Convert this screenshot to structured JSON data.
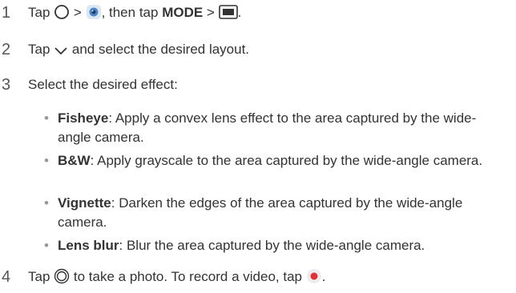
{
  "steps": [
    {
      "number": "1",
      "text_a": "Tap",
      "text_b": ">",
      "text_c": ", then tap",
      "mode_label": "MODE",
      "text_d": ">",
      "text_e": "."
    },
    {
      "number": "2",
      "text_a": "Tap",
      "text_b": "and select the desired layout."
    },
    {
      "number": "3",
      "text": "Select the desired effect:"
    },
    {
      "number": "4",
      "text_a": "Tap",
      "text_b": "to take a photo. To record a video, tap",
      "text_c": "."
    }
  ],
  "effects": [
    {
      "name": "Fisheye",
      "description": ": Apply a convex lens effect to the area captured by the wide-angle camera."
    },
    {
      "name": "B&W",
      "description": ": Apply grayscale to the area captured by the wide-angle camera."
    },
    {
      "name": "Vignette",
      "description": ": Darken the edges of the area captured by the wide-angle camera."
    },
    {
      "name": "Lens blur",
      "description": ": Blur the area captured by the wide-angle camera."
    }
  ],
  "bullet_char": "•",
  "icons": {
    "home": "home-circle-icon",
    "camera_app": "camera-app-icon",
    "mode_layout": "layout-mode-icon",
    "dropdown": "chevron-down-icon",
    "shutter": "shutter-icon",
    "record": "record-icon"
  },
  "colors": {
    "text": "#333333",
    "camera_blue": "#4a86c8",
    "record_red": "#e0303a"
  }
}
